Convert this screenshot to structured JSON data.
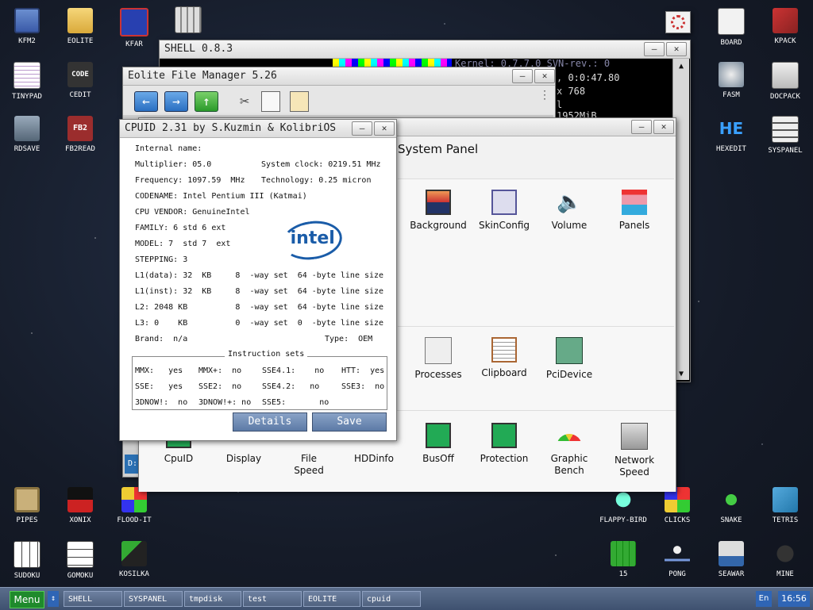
{
  "desktop": {
    "icons": [
      {
        "label": "KFM2"
      },
      {
        "label": "EOLITE"
      },
      {
        "label": "KFAR"
      },
      {
        "label": "TINYPAD"
      },
      {
        "label": "CEDIT"
      },
      {
        "label": "RDSAVE"
      },
      {
        "label": "FB2READ"
      },
      {
        "label": "BOARD"
      },
      {
        "label": "KPACK"
      },
      {
        "label": "FASM"
      },
      {
        "label": "DOCPACK"
      },
      {
        "label": "HEXEDIT"
      },
      {
        "label": "SYSPANEL"
      },
      {
        "label": "PIPES"
      },
      {
        "label": "XONIX"
      },
      {
        "label": "FLOOD-IT"
      },
      {
        "label": "SUDOKU"
      },
      {
        "label": "GOMOKU"
      },
      {
        "label": "KOSILKA"
      },
      {
        "label": "FLAPPY-BIRD"
      },
      {
        "label": "CLICKS"
      },
      {
        "label": "SNAKE"
      },
      {
        "label": "TETRIS"
      },
      {
        "label": "15"
      },
      {
        "label": "PONG"
      },
      {
        "label": "SEAWAR"
      },
      {
        "label": "MINE"
      }
    ],
    "code_icon_text": "CODE",
    "fb2_icon_text": "FB2",
    "he_icon_text": "HE"
  },
  "shell": {
    "title": "SHELL 0.8.3",
    "lines": [
      "Kernel: 0.7.7.0  SVN-rev.: 0",
      ", 0:0:47.80",
      " x 768",
      "l",
      " 1952MiB"
    ]
  },
  "eolite": {
    "title": "Eolite File Manager 5.26",
    "side_letter": "D:"
  },
  "syspanel": {
    "title": "System Panel",
    "items": [
      {
        "label": "Background"
      },
      {
        "label": "SkinConfig"
      },
      {
        "label": "Volume"
      },
      {
        "label": "Panels"
      },
      {
        "label": "Processes"
      },
      {
        "label": "Clipboard"
      },
      {
        "label": "PciDevice"
      },
      {
        "label": "CpuID"
      },
      {
        "label": "Display"
      },
      {
        "label": "File\nSpeed"
      },
      {
        "label": "HDDinfo"
      },
      {
        "label": "BusOff"
      },
      {
        "label": "Protection"
      },
      {
        "label": "Graphic\nBench"
      },
      {
        "label": "Network\nSpeed"
      }
    ]
  },
  "cpuid": {
    "title": "CPUID 2.31 by S.Kuzmin & KolibriOS",
    "internal_name": "Internal name:",
    "multiplier": "Multiplier: 05.0",
    "system_clock": "System clock: 0219.51 MHz",
    "frequency": "Frequency: 1097.59  MHz",
    "technology": "Technology: 0.25 micron",
    "codename": "CODENAME: Intel Pentium III (Katmai)",
    "vendor": "CPU VENDOR: GenuineIntel",
    "family": "FAMILY: 6 std 6 ext",
    "model": "MODEL: 7  std 7  ext",
    "stepping": "STEPPING: 3",
    "cache": [
      "L1(data): 32  KB     8  -way set  64 -byte line size",
      "L1(inst): 32  KB     8  -way set  64 -byte line size",
      "L2: 2048 KB          8  -way set  64 -byte line size",
      "L3: 0    KB          0  -way set  0  -byte line size"
    ],
    "brand": "Brand:  n/a",
    "type": "Type:  OEM",
    "logo_text": "intel",
    "instr_title": "Instruction sets",
    "instr_rows": [
      [
        "MMX:   yes",
        "MMX+:  no",
        "SSE4.1:    no",
        "HTT:  yes"
      ],
      [
        "SSE:   yes",
        "SSE2:  no",
        "SSE4.2:   no",
        "SSE3:  no"
      ],
      [
        "3DNOW!:  no",
        "3DNOW!+: no",
        "SSE5:       no",
        ""
      ]
    ],
    "details_label": "Details",
    "save_label": "Save"
  },
  "taskbar": {
    "menu_label": "Menu",
    "tasks": [
      "SHELL",
      "SYSPANEL",
      "tmpdisk",
      "test",
      "EOLITE",
      "cpuid"
    ],
    "lang": "En",
    "clock": "16:56"
  }
}
